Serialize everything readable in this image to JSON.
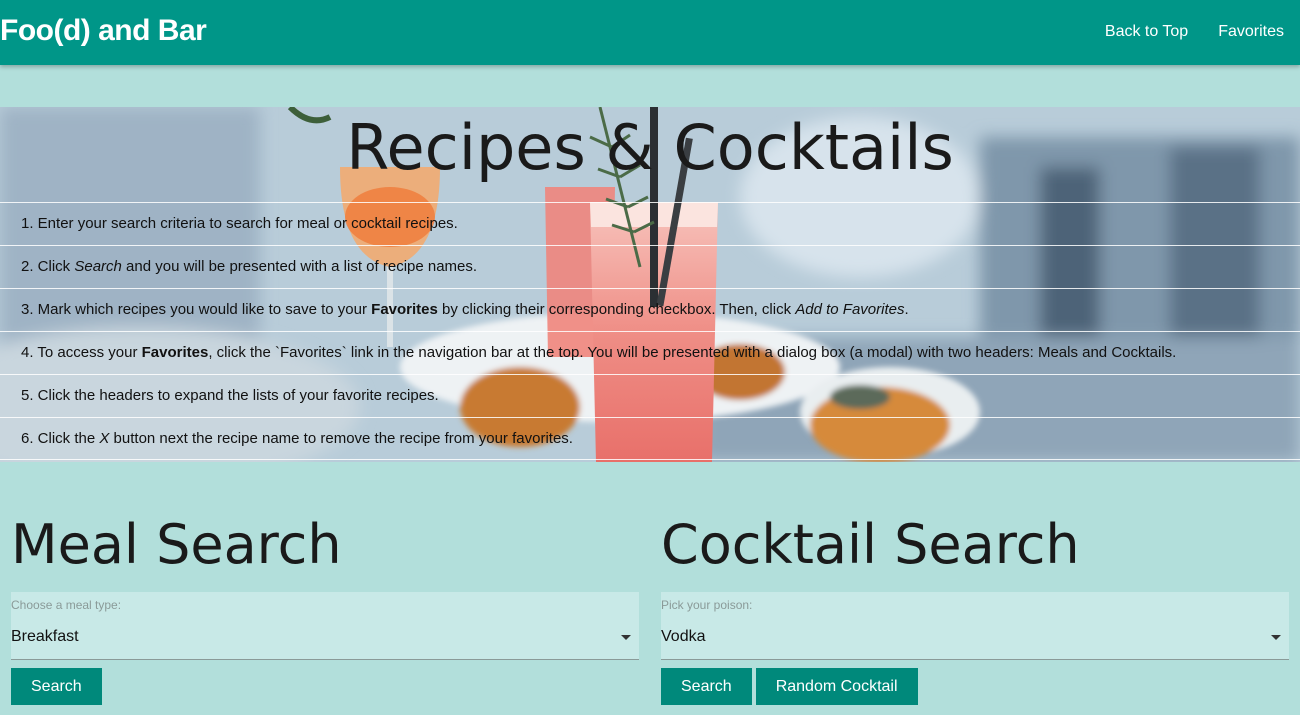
{
  "nav": {
    "brand": "Foo(d) and Bar",
    "links": [
      "Back to Top",
      "Favorites"
    ]
  },
  "hero": {
    "title": "Recipes & Cocktails",
    "steps": [
      {
        "parts": [
          {
            "t": "1. Enter your search criteria to search for meal or cocktail recipes."
          }
        ]
      },
      {
        "parts": [
          {
            "t": "2. Click "
          },
          {
            "t": "Search",
            "s": "i"
          },
          {
            "t": " and you will be presented with a list of recipe names."
          }
        ]
      },
      {
        "parts": [
          {
            "t": "3. Mark which recipes you would like to save to your "
          },
          {
            "t": "Favorites",
            "s": "b"
          },
          {
            "t": " by clicking their corresponding checkbox. Then, click "
          },
          {
            "t": "Add to Favorites",
            "s": "i"
          },
          {
            "t": "."
          }
        ]
      },
      {
        "parts": [
          {
            "t": "4. To access your "
          },
          {
            "t": "Favorites",
            "s": "b"
          },
          {
            "t": ", click the `Favorites` link in the navigation bar at the top. You will be presented with a dialog box (a modal) with two headers: Meals and Cocktails."
          }
        ]
      },
      {
        "parts": [
          {
            "t": "5. Click the headers to expand the lists of your favorite recipes."
          }
        ]
      },
      {
        "parts": [
          {
            "t": "6. Click the "
          },
          {
            "t": "X",
            "s": "i"
          },
          {
            "t": " button next the recipe name to remove the recipe from your favorites."
          }
        ]
      }
    ]
  },
  "meal": {
    "title": "Meal Search",
    "select_label": "Choose a meal type:",
    "select_value": "Breakfast",
    "search_button": "Search"
  },
  "cocktail": {
    "title": "Cocktail Search",
    "select_label": "Pick your poison:",
    "select_value": "Vodka",
    "search_button": "Search",
    "random_button": "Random Cocktail"
  },
  "colors": {
    "navbar": "#009688",
    "page_background": "#b2dfdb",
    "button": "#00897b",
    "select_background": "#c8e9e7"
  }
}
